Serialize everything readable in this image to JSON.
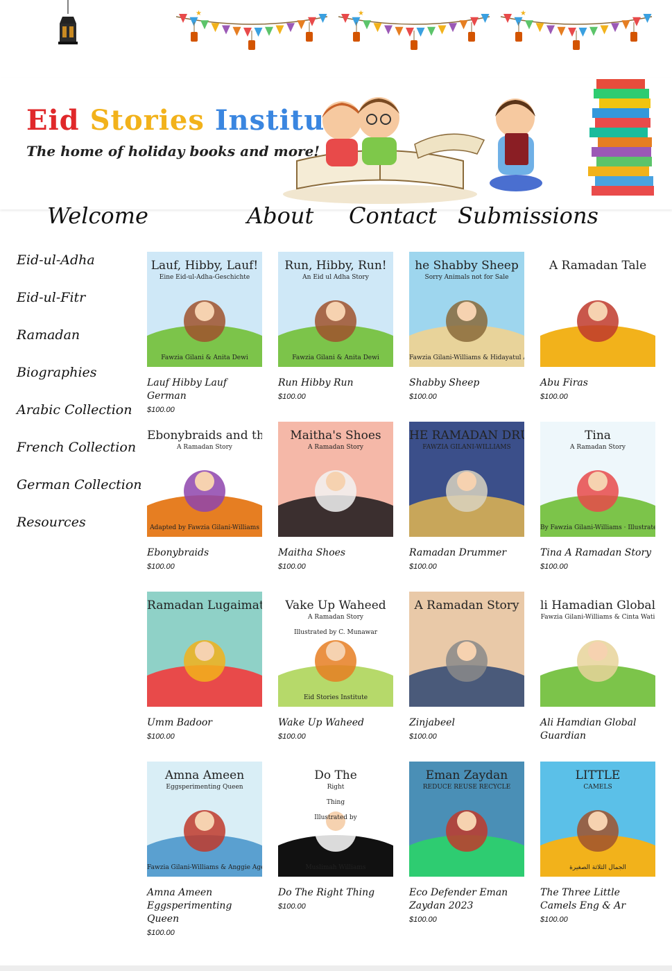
{
  "header": {
    "brand_title_words": [
      "Eid",
      "Stories",
      "Institute"
    ],
    "brand_subtitle": "The home of holiday books and more!",
    "logo_icon": "crescent-lantern-icon",
    "bunting_icon": "festive-bunting-icon",
    "hero_image": "children-reading-books-illustration"
  },
  "colors": {
    "title_word_1": "#e0282a",
    "title_word_2": "#f2b21b",
    "title_word_3": "#3a86e0",
    "text": "#111111"
  },
  "nav": {
    "items": [
      "Welcome",
      "About",
      "Contact",
      "Submissions"
    ]
  },
  "sidebar": {
    "items": [
      "Eid-ul-Adha",
      "Eid-ul-Fitr",
      "Ramadan",
      "Biographies",
      "Arabic Collection",
      "French Collection",
      "German Collection",
      "Resources"
    ]
  },
  "products": [
    {
      "title": "Lauf Hibby Lauf German",
      "price": "$100.00",
      "cover_text": [
        "Lauf, Hibby, Lauf!",
        "Eine Eid-ul-Adha-Geschichte",
        "Fawzia Gilani & Anita Dewi"
      ]
    },
    {
      "title": "Run Hibby Run",
      "price": "$100.00",
      "cover_text": [
        "Run, Hibby, Run!",
        "An Eid ul Adha Story",
        "Fawzia Gilani & Anita Dewi"
      ]
    },
    {
      "title": "Shabby Sheep",
      "price": "$100.00",
      "cover_text": [
        "he Shabby Sheep",
        "Sorry Animals not for Sale",
        "Fawzia Gilani-Williams & Hidayatul Azmi"
      ]
    },
    {
      "title": "Abu Firas",
      "price": "$100.00",
      "cover_text": [
        "A Ramadan Tale"
      ]
    },
    {
      "title": "Ebonybraids",
      "price": "$100.00",
      "cover_text": [
        "Ebonybraids and the Three Camels",
        "A Ramadan Story",
        "Adapted by Fawzia Gilani-Williams"
      ]
    },
    {
      "title": "Maitha Shoes",
      "price": "$100.00",
      "cover_text": [
        "Maitha's Shoes",
        "A Ramadan Story"
      ]
    },
    {
      "title": "Ramadan Drummer",
      "price": "$100.00",
      "cover_text": [
        "HE RAMADAN DRUMME",
        "FAWZIA GILANI-WILLIAMS"
      ]
    },
    {
      "title": "Tina A Ramadan Story",
      "price": "$100.00",
      "cover_text": [
        "Tina",
        "A Ramadan Story",
        "By Fawzia Gilani-Williams · Illustrated by Hidayatul Azmi"
      ]
    },
    {
      "title": "Umm Badoor",
      "price": "$100.00",
      "cover_text": [
        "Ramadan Lugaimat"
      ]
    },
    {
      "title": "Wake Up Waheed",
      "price": "$100.00",
      "cover_text": [
        "Vake Up Waheed",
        "A Ramadan Story",
        "Illustrated by C. Munawar",
        "Eid Stories Institute"
      ]
    },
    {
      "title": "Zinjabeel",
      "price": "$100.00",
      "cover_text": [
        "A Ramadan Story"
      ]
    },
    {
      "title": "Ali Hamdian Global Guardian",
      "price": "",
      "cover_text": [
        "li Hamadian Global Guardia",
        "Fawzia Gilani-Williams & Cinta Wati"
      ]
    },
    {
      "title": "Amna Ameen Eggsperimenting Queen",
      "price": "$100.00",
      "cover_text": [
        "Amna Ameen",
        "Eggsperimenting Queen",
        "Fawzia Gilani-Williams & Anggie Agen"
      ]
    },
    {
      "title": "Do The Right Thing",
      "price": "$100.00",
      "cover_text": [
        "Do The",
        "Right",
        "Thing",
        "Illustrated by",
        "Muslimah Williams"
      ]
    },
    {
      "title": "Eco Defender Eman Zaydan 2023",
      "price": "$100.00",
      "cover_text": [
        "Eman Zaydan",
        "REDUCE REUSE RECYCLE"
      ]
    },
    {
      "title": "The Three Little Camels Eng & Ar",
      "price": "$100.00",
      "cover_text": [
        "LITTLE",
        "CAMELS",
        "الجمال الثلاثة الصغيرة"
      ]
    }
  ]
}
